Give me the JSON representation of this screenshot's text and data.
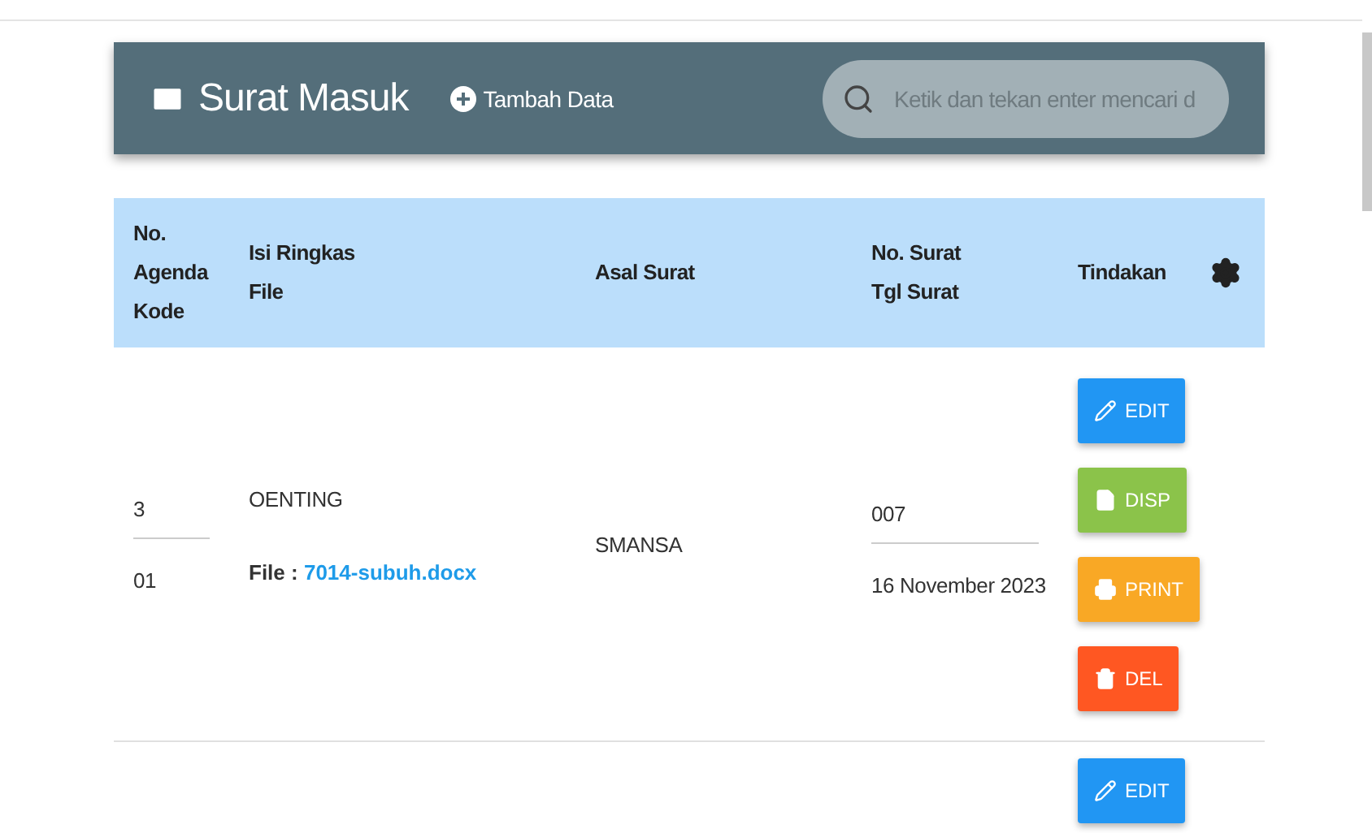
{
  "header": {
    "title": "Surat Masuk",
    "add_button": "Tambah Data",
    "search": {
      "placeholder": "Ketik dan tekan enter mencari d"
    }
  },
  "table": {
    "columns": [
      {
        "lines": [
          "No.",
          "Agenda",
          "Kode"
        ]
      },
      {
        "lines": [
          "Isi Ringkas",
          "File"
        ]
      },
      {
        "lines": [
          "Asal Surat"
        ]
      },
      {
        "lines": [
          "No. Surat",
          "Tgl Surat"
        ]
      },
      {
        "lines": [
          "Tindakan"
        ]
      }
    ],
    "rows": [
      {
        "agenda": "3",
        "kode": "01",
        "isi": "OENTING",
        "file_label": "File :",
        "file": "7014-subuh.docx",
        "asal": "SMANSA",
        "no_surat": "007",
        "tgl_surat": "16 November 2023",
        "actions": [
          {
            "kind": "edit",
            "label": "EDIT"
          },
          {
            "kind": "disp",
            "label": "DISP"
          },
          {
            "kind": "print",
            "label": "PRINT"
          },
          {
            "kind": "del",
            "label": "DEL"
          }
        ]
      },
      {
        "actions": [
          {
            "kind": "edit",
            "label": "EDIT"
          }
        ]
      }
    ]
  }
}
